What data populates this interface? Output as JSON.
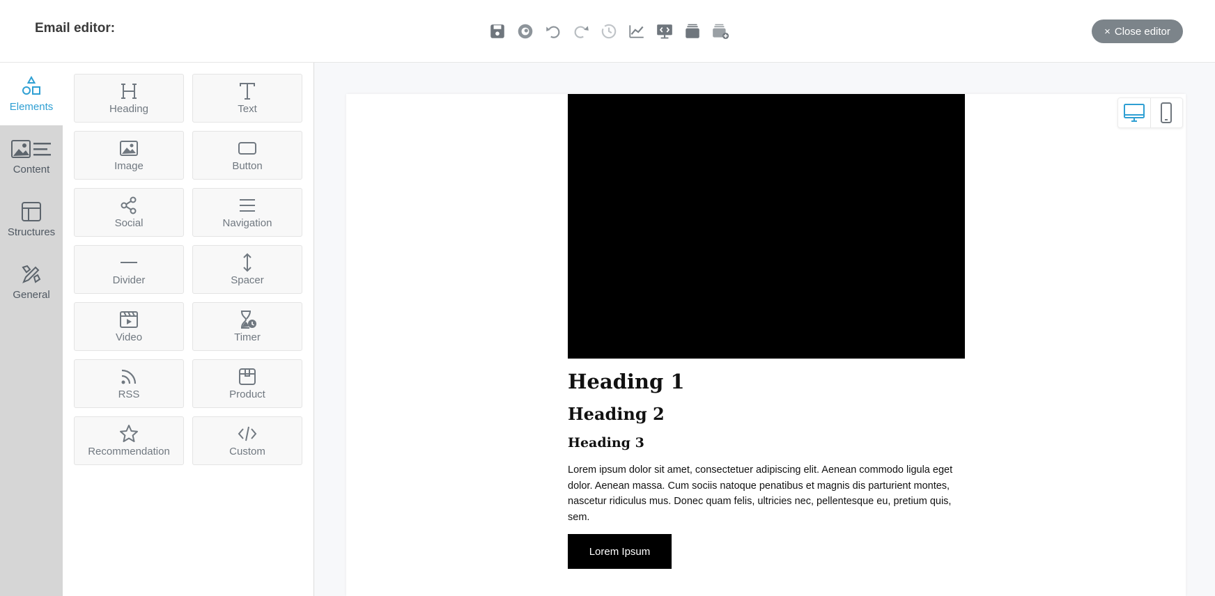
{
  "header": {
    "title": "Email editor:",
    "toolbar": [
      {
        "icon": "save-icon"
      },
      {
        "icon": "preview-icon"
      },
      {
        "icon": "undo-icon"
      },
      {
        "icon": "redo-icon"
      },
      {
        "icon": "history-icon"
      },
      {
        "icon": "analytics-icon"
      },
      {
        "icon": "code-view-icon"
      },
      {
        "icon": "templates-icon"
      },
      {
        "icon": "save-template-icon"
      }
    ],
    "close_label": "Close editor",
    "close_icon": "×"
  },
  "sidebar": {
    "items": [
      {
        "label": "Elements",
        "icon": "elements-icon",
        "active": true
      },
      {
        "label": "Content",
        "icon": "content-icon"
      },
      {
        "label": "Structures",
        "icon": "structures-icon"
      },
      {
        "label": "General",
        "icon": "general-icon"
      }
    ]
  },
  "elements": {
    "tiles": [
      {
        "label": "Heading",
        "icon": "heading-icon"
      },
      {
        "label": "Text",
        "icon": "text-icon"
      },
      {
        "label": "Image",
        "icon": "image-icon"
      },
      {
        "label": "Button",
        "icon": "button-icon"
      },
      {
        "label": "Social",
        "icon": "social-icon"
      },
      {
        "label": "Navigation",
        "icon": "navigation-icon"
      },
      {
        "label": "Divider",
        "icon": "divider-icon"
      },
      {
        "label": "Spacer",
        "icon": "spacer-icon"
      },
      {
        "label": "Video",
        "icon": "video-icon"
      },
      {
        "label": "Timer",
        "icon": "timer-icon"
      },
      {
        "label": "RSS",
        "icon": "rss-icon"
      },
      {
        "label": "Product",
        "icon": "product-icon"
      },
      {
        "label": "Recommendation",
        "icon": "recommendation-icon"
      },
      {
        "label": "Custom",
        "icon": "custom-code-icon"
      }
    ]
  },
  "canvas": {
    "heading1": "Heading 1",
    "heading2": "Heading 2",
    "heading3": "Heading 3",
    "paragraph": "Lorem ipsum dolor sit amet, consectetuer adipiscing elit. Aenean commodo ligula eget dolor. Aenean massa. Cum sociis natoque penatibus et magnis dis parturient montes, nascetur ridiculus mus. Donec quam felis, ultricies nec, pellentesque eu, pretium quis, sem.",
    "button_label": "Lorem Ipsum"
  },
  "device_toggle": {
    "active": "desktop",
    "options": [
      {
        "icon": "desktop-icon"
      },
      {
        "icon": "mobile-icon"
      }
    ]
  },
  "colors": {
    "accent": "#2e9fd3",
    "icon_gray": "#707880",
    "close_button": "#7c848a"
  }
}
